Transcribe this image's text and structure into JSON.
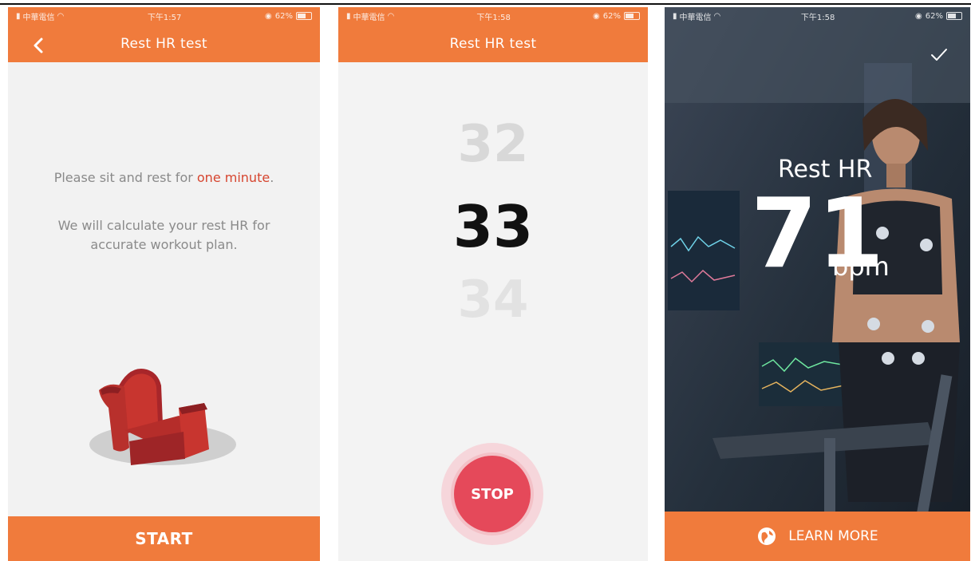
{
  "colors": {
    "accent": "#f07b3c",
    "highlight": "#d6452f",
    "stop": "#e5495a"
  },
  "status_bar": {
    "left": [
      {
        "carrier": "中華電信",
        "time": "下午1:57",
        "battery": "62%"
      },
      {
        "carrier": "中華電信",
        "time": "下午1:58",
        "battery": "62%"
      },
      {
        "carrier": "中華電信",
        "time": "下午1:58",
        "battery": "62%"
      }
    ]
  },
  "screen1": {
    "title": "Rest HR test",
    "back_icon": "chevron-left-icon",
    "line1_prefix": "Please sit and rest for ",
    "line1_highlight": "one minute",
    "line1_suffix": ".",
    "line2": "We will calculate your rest HR for",
    "line3": "accurate workout plan.",
    "illustration": "armchair-illustration",
    "start_label": "START"
  },
  "screen2": {
    "title": "Rest HR test",
    "prev_value": "32",
    "current_value": "33",
    "next_value": "34",
    "stop_label": "STOP"
  },
  "screen3": {
    "check_icon": "checkmark-icon",
    "rest_label": "Rest HR",
    "hr_value": "71",
    "unit": "bpm",
    "learn_icon": "globe-icon",
    "learn_label": "LEARN MORE"
  }
}
